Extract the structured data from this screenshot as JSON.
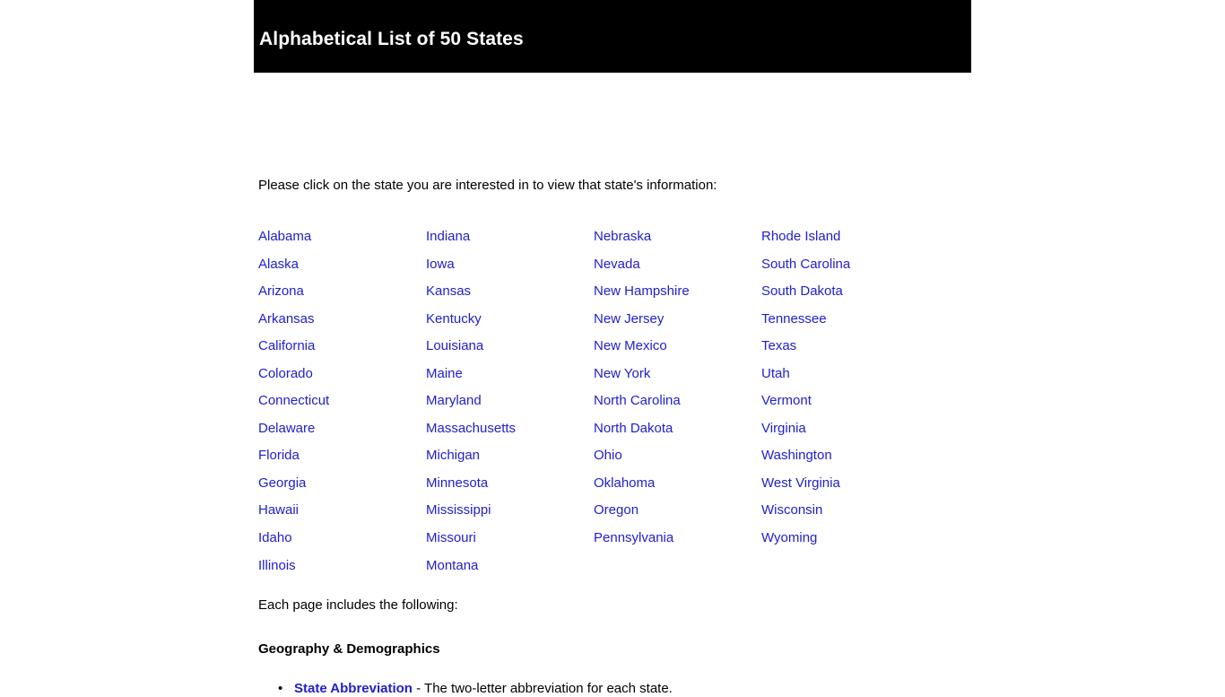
{
  "header": {
    "title": "Alphabetical List of 50 States"
  },
  "intro": {
    "text": "Please click on the state you are interested in to view that state's information:"
  },
  "states": {
    "columns": [
      {
        "items": [
          "Alabama",
          "Alaska",
          "Arizona",
          "Arkansas",
          "California",
          "Colorado",
          "Connecticut",
          "Delaware",
          "Florida",
          "Georgia",
          "Hawaii",
          "Idaho",
          "Illinois"
        ]
      },
      {
        "items": [
          "Indiana",
          "Iowa",
          "Kansas",
          "Kentucky",
          "Louisiana",
          "Maine",
          "Maryland",
          "Massachusetts",
          "Michigan",
          "Minnesota",
          "Mississippi",
          "Missouri",
          "Montana"
        ]
      },
      {
        "items": [
          "Nebraska",
          "Nevada",
          "New Hampshire",
          "New Jersey",
          "New Mexico",
          "New York",
          "North Carolina",
          "North Dakota",
          "Ohio",
          "Oklahoma",
          "Oregon",
          "Pennsylvania"
        ]
      },
      {
        "items": [
          "Rhode Island",
          "South Carolina",
          "South Dakota",
          "Tennessee",
          "Texas",
          "Utah",
          "Vermont",
          "Virginia",
          "Washington",
          "West Virginia",
          "Wisconsin",
          "Wyoming"
        ]
      }
    ]
  },
  "footer": {
    "each_page_label": "Each page includes the following:",
    "section_heading": "Geography & Demographics",
    "bullets": [
      {
        "term": "State Abbreviation",
        "description": " - The two-letter abbreviation for each state."
      }
    ]
  },
  "colors": {
    "banner_background": "#000000",
    "banner_text": "#ffffff",
    "link": "#2020d0",
    "body_text": "#000000",
    "page_background": "#ffffff"
  }
}
